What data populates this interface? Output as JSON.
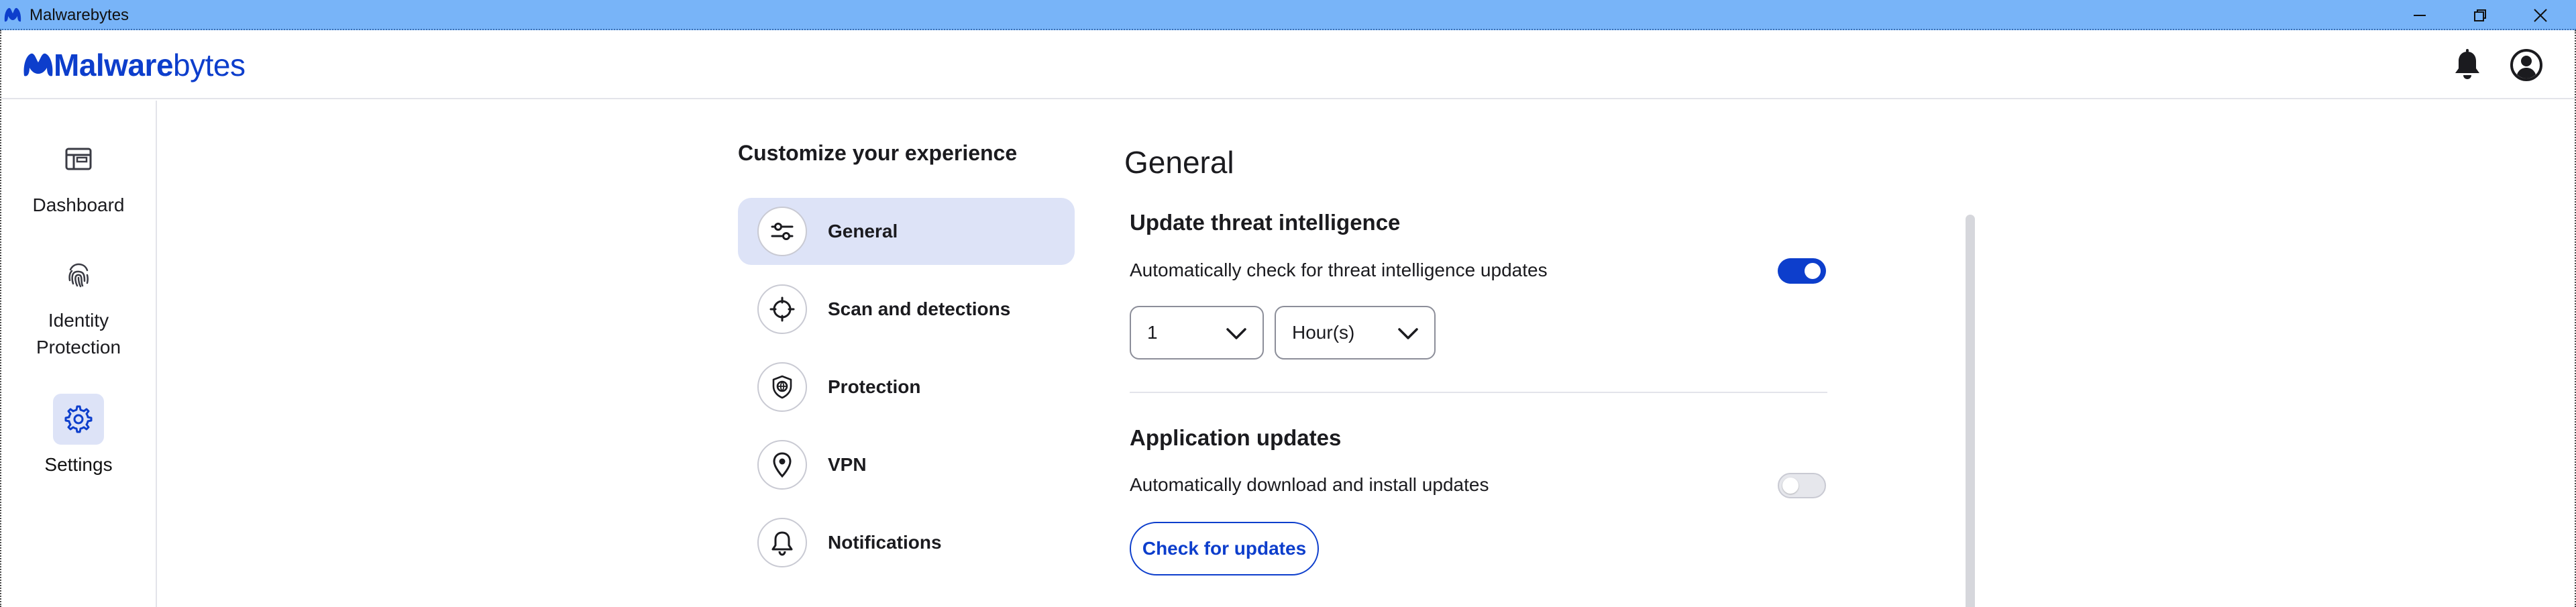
{
  "window": {
    "title": "Malwarebytes",
    "titlebar_color": "#78b4f8",
    "controls": [
      "minimize-icon",
      "restore-icon",
      "close-icon"
    ]
  },
  "header": {
    "logo_bold": "Malware",
    "logo_light": "bytes",
    "brand_color": "#0d3ecc",
    "icons": [
      "bell-icon",
      "account-icon"
    ]
  },
  "sidebar": {
    "items": [
      {
        "label": "Dashboard",
        "icon": "dashboard-icon",
        "active": false
      },
      {
        "label": "Identity\nProtection",
        "icon": "fingerprint-icon",
        "active": false
      },
      {
        "label": "Settings",
        "icon": "gear-icon",
        "active": true
      }
    ],
    "active_bg": "#dde3f7"
  },
  "settings_nav": {
    "title": "Customize your experience",
    "items": [
      {
        "label": "General",
        "icon": "sliders-icon",
        "active": true
      },
      {
        "label": "Scan and detections",
        "icon": "crosshair-icon",
        "active": false
      },
      {
        "label": "Protection",
        "icon": "shield-icon",
        "active": false
      },
      {
        "label": "VPN",
        "icon": "location-pin-icon",
        "active": false
      },
      {
        "label": "Notifications",
        "icon": "bell-icon",
        "active": false
      }
    ]
  },
  "content": {
    "title": "General",
    "sections": [
      {
        "title": "Update threat intelligence",
        "setting_label": "Automatically check for threat intelligence updates",
        "toggle_on": true,
        "interval_value": "1",
        "interval_unit": "Hour(s)"
      },
      {
        "title": "Application updates",
        "setting_label": "Automatically download and install updates",
        "toggle_on": false,
        "button_label": "Check for updates"
      }
    ]
  }
}
